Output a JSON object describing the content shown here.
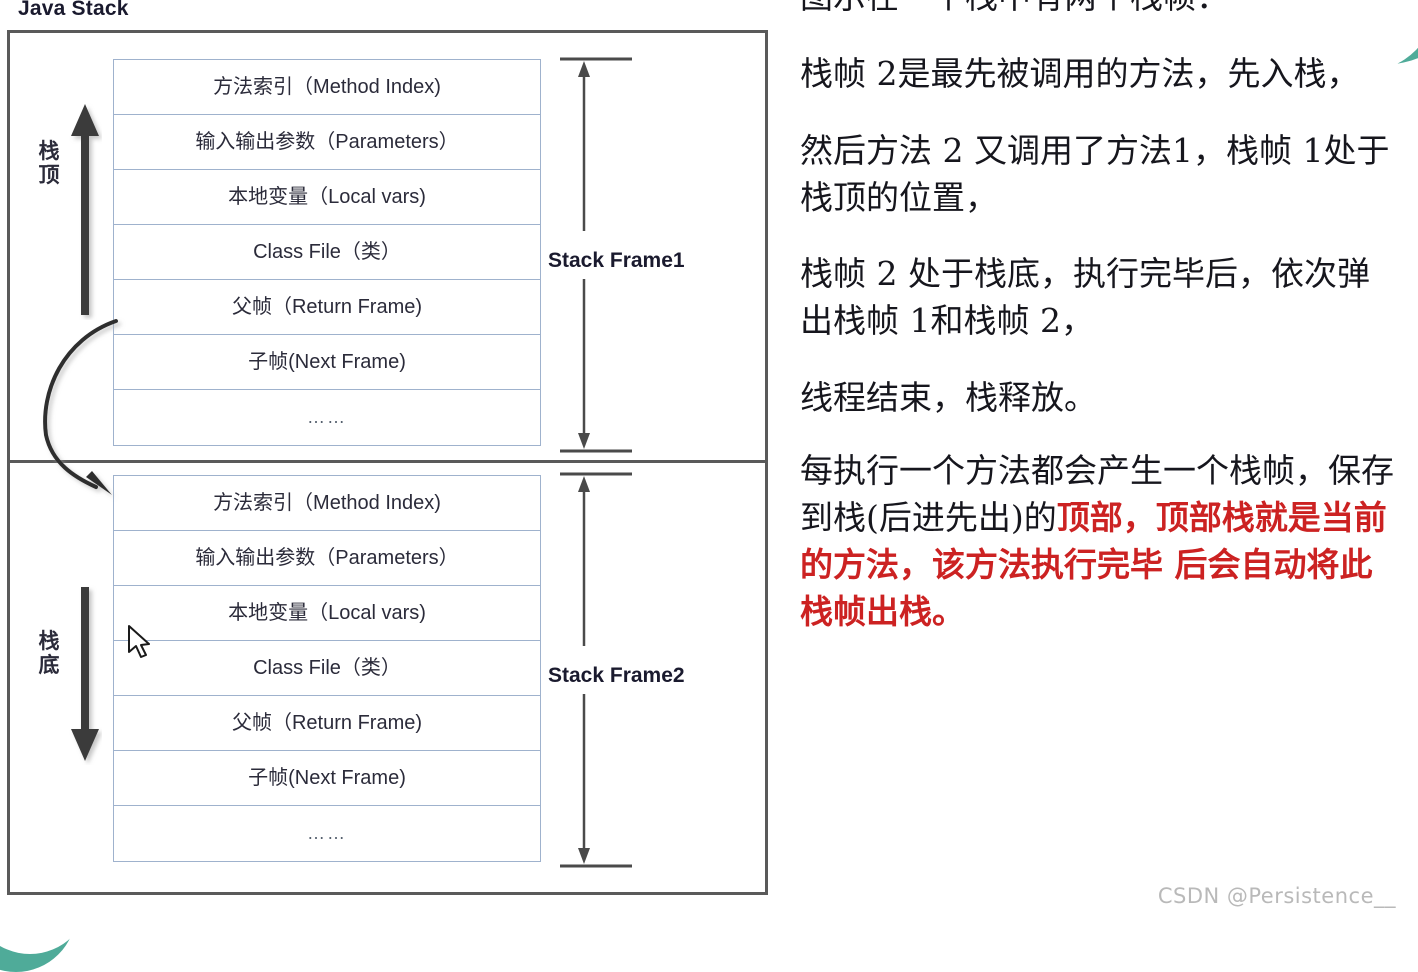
{
  "diagram": {
    "title": "Java Stack",
    "side_labels": {
      "top": "栈顶",
      "bottom": "栈底"
    },
    "frames": [
      {
        "bracket_label": "Stack Frame1",
        "rows": [
          "方法索引（Method Index)",
          "输入输出参数（Parameters）",
          "本地变量（Local vars)",
          "Class File（类）",
          "父帧（Return Frame)",
          "子帧(Next Frame)",
          "……"
        ]
      },
      {
        "bracket_label": "Stack Frame2",
        "rows": [
          "方法索引（Method Index)",
          "输入输出参数（Parameters）",
          "本地变量（Local vars)",
          "Class File（类）",
          "父帧（Return Frame)",
          "子帧(Next Frame)",
          "……"
        ]
      }
    ]
  },
  "notes": {
    "p1": "图示在一个栈中有两个栈帧：",
    "p2": "栈帧 2是最先被调用的方法，先入栈，",
    "p3": "然后方法 2 又调用了方法1，栈帧 1处于栈顶的位置，",
    "p4": "栈帧 2 处于栈底，执行完毕后，依次弹出栈帧 1和栈帧 2，",
    "p5": "线程结束，栈释放。",
    "p6_plain": "每执行一个方法都会产生一个栈帧，保存到栈(后进先出)的",
    "p6_highlight": "顶部，",
    "p7_red": "顶部栈就是当前的方法，该方法执行完毕 后会自动将此栈帧出栈。"
  },
  "watermark": "CSDN @Persistence__",
  "colors": {
    "accent_teal": "#4fab99",
    "highlight_red": "#cc2222",
    "frame_border": "#9fb2cd",
    "outer_border": "#5a5a5a"
  }
}
